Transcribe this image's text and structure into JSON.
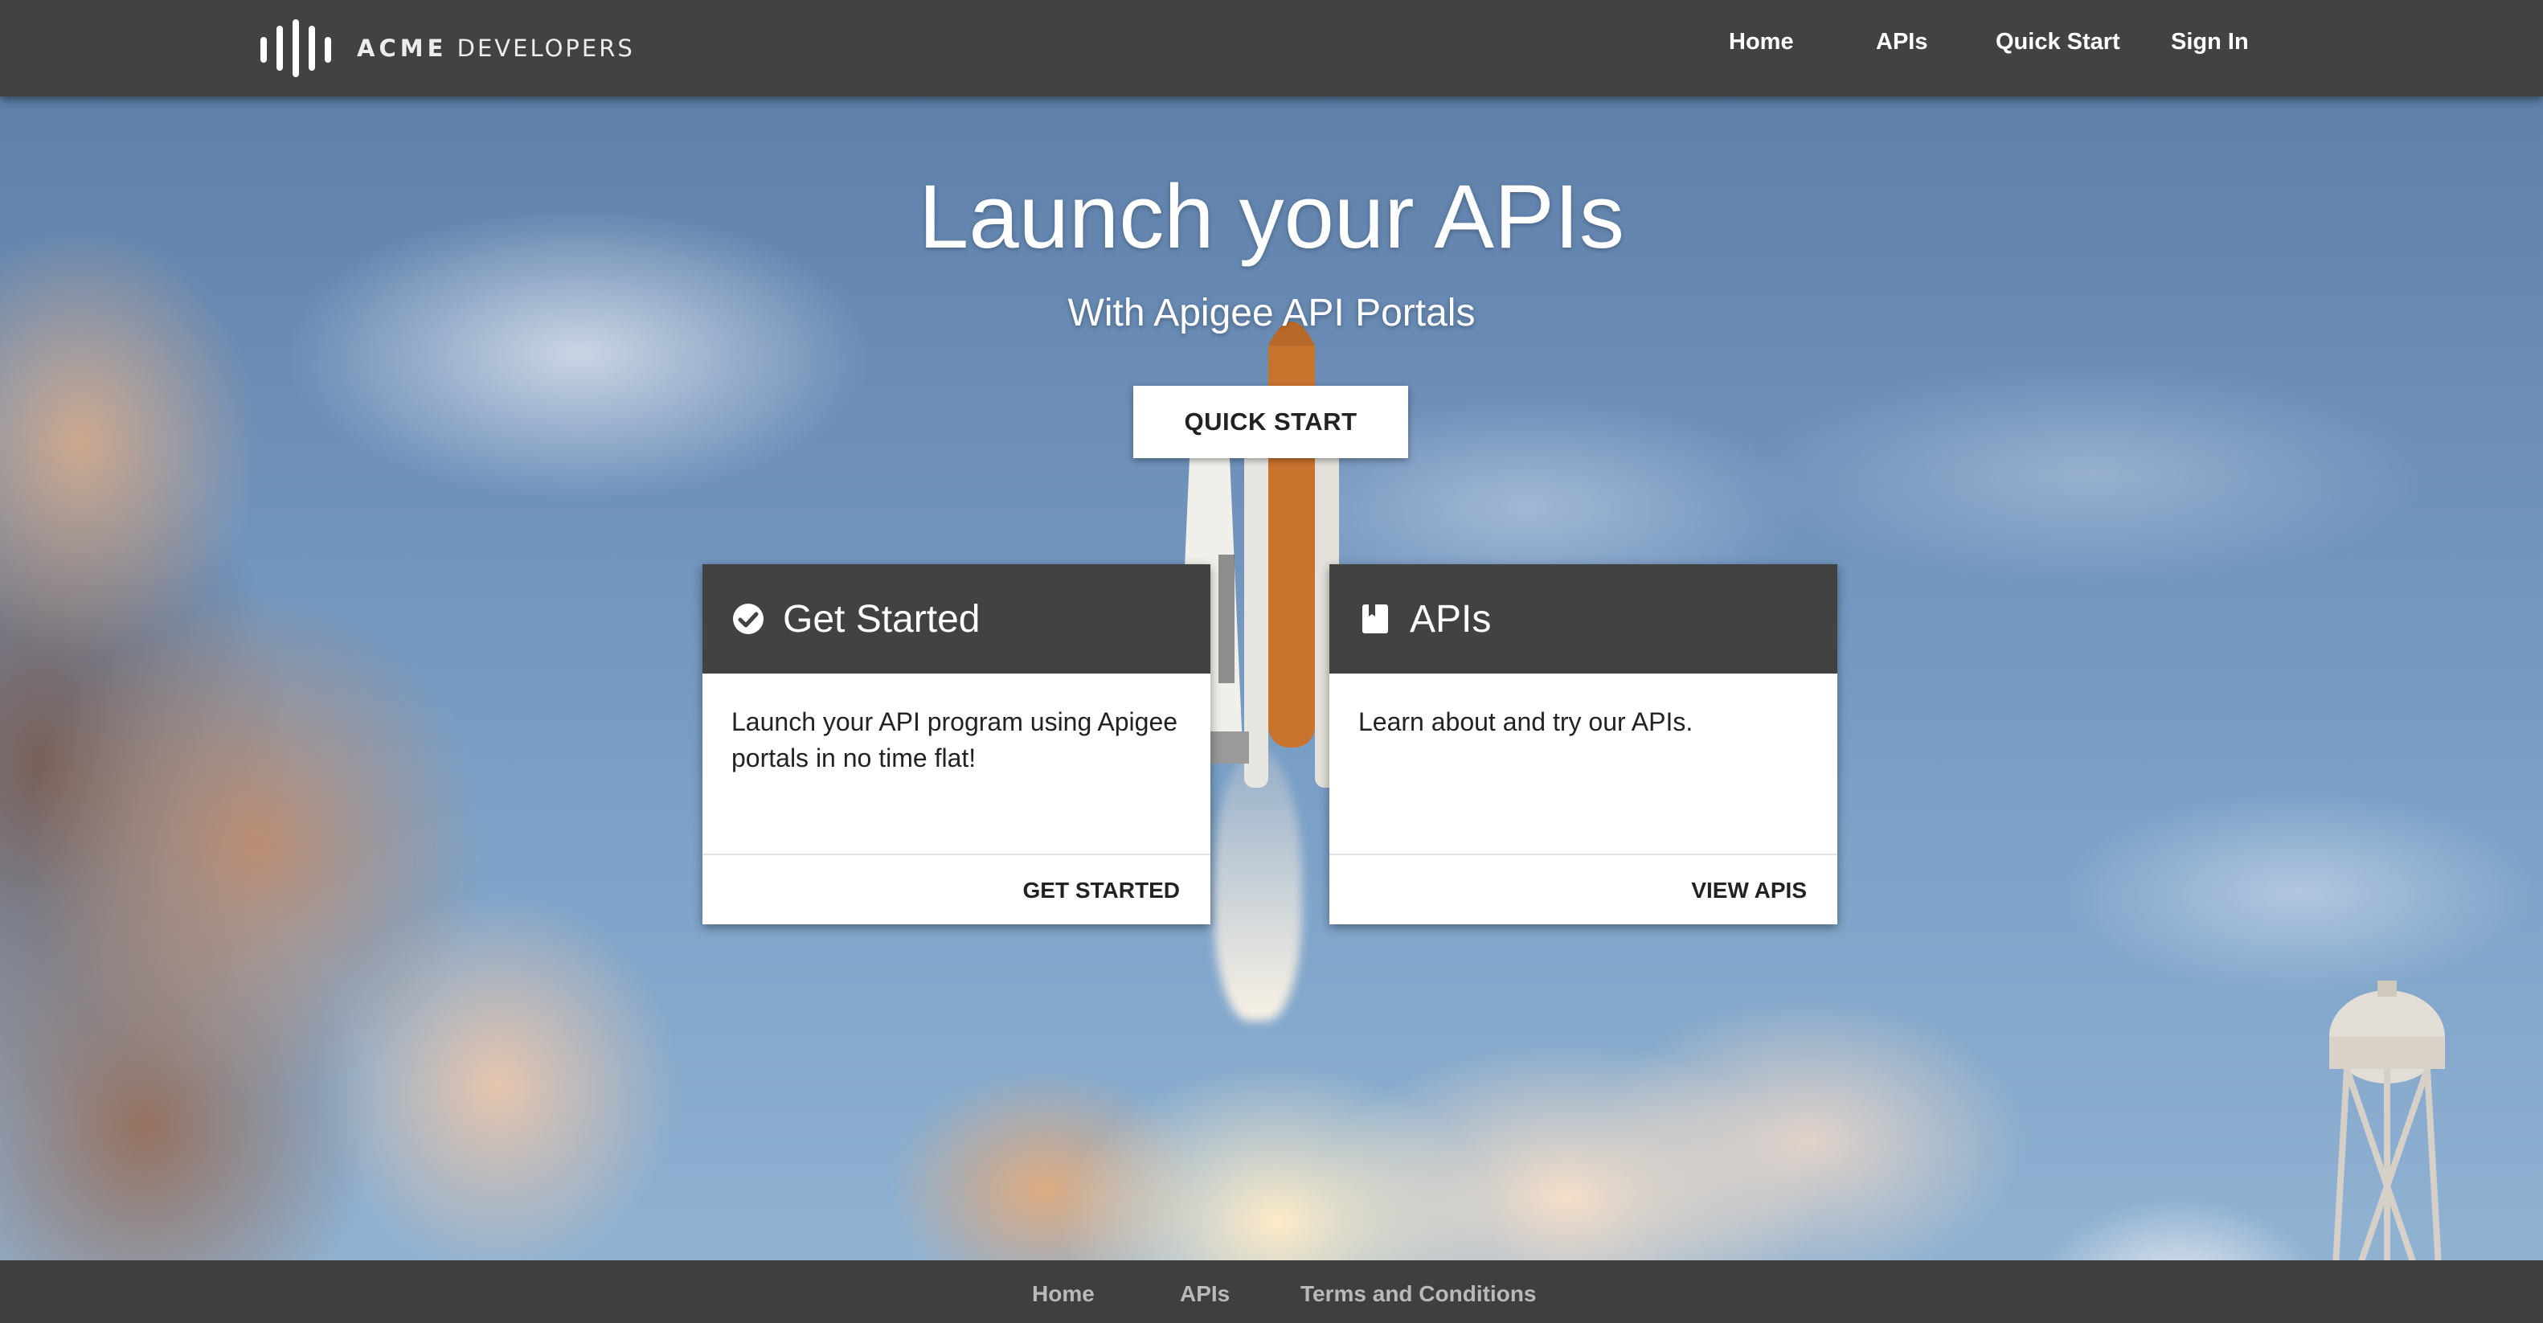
{
  "header": {
    "logo_text_bold": "ACME",
    "logo_text_rest": "DEVELOPERS",
    "nav": [
      {
        "label": "Home"
      },
      {
        "label": "APIs"
      },
      {
        "label": "Quick Start"
      },
      {
        "label": "Sign In"
      }
    ]
  },
  "hero": {
    "title": "Launch your APIs",
    "subtitle": "With Apigee API Portals",
    "cta_label": "QUICK START"
  },
  "cards": [
    {
      "icon": "check-circle-icon",
      "title": "Get Started",
      "body": "Launch your API program using Apigee portals in no time flat!",
      "action": "GET STARTED"
    },
    {
      "icon": "book-icon",
      "title": "APIs",
      "body": "Learn about and try our APIs.",
      "action": "VIEW APIS"
    }
  ],
  "footer": {
    "links": [
      {
        "label": "Home"
      },
      {
        "label": "APIs"
      },
      {
        "label": "Terms and Conditions"
      }
    ]
  },
  "colors": {
    "header_bg": "#424242",
    "card_header_bg": "#424242",
    "footer_bg": "#3f3f3f",
    "footer_link": "#b9b9b9"
  }
}
